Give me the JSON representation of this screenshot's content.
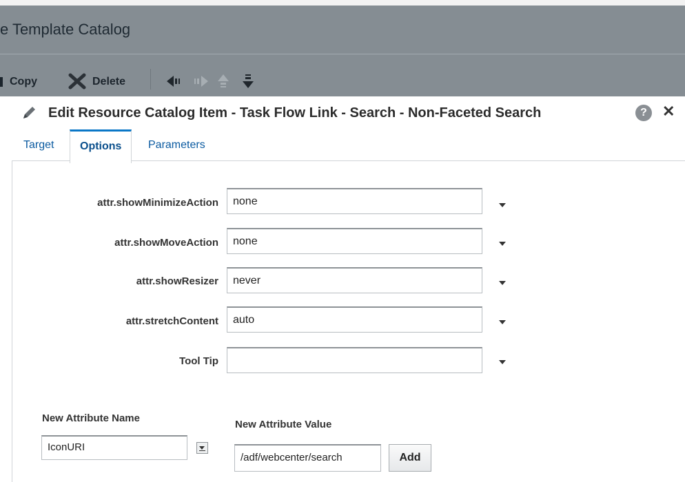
{
  "background": {
    "title": "e Template Catalog",
    "toolbar": {
      "copy_label": "Copy",
      "delete_label": "Delete"
    }
  },
  "dialog": {
    "title": "Edit Resource Catalog Item - Task Flow Link - Search - Non-Faceted Search",
    "help_icon": "?",
    "close_icon": "✕",
    "tabs": [
      {
        "label": "Target"
      },
      {
        "label": "Options"
      },
      {
        "label": "Parameters"
      }
    ],
    "active_tab": "Options",
    "options": [
      {
        "label": "attr.showMinimizeAction",
        "value": "none"
      },
      {
        "label": "attr.showMoveAction",
        "value": "none"
      },
      {
        "label": "attr.showResizer",
        "value": "never"
      },
      {
        "label": "attr.stretchContent",
        "value": "auto"
      },
      {
        "label": "Tool Tip",
        "value": ""
      }
    ],
    "new_attribute": {
      "name_label": "New Attribute Name",
      "name_value": "IconURI",
      "value_label": "New Attribute Value",
      "value_value": "/adf/webcenter/search",
      "add_label": "Add"
    }
  },
  "colors": {
    "overlay_gray": "#858d93",
    "link_blue": "#0a5aa0",
    "active_tab_border": "#0a77c7"
  }
}
